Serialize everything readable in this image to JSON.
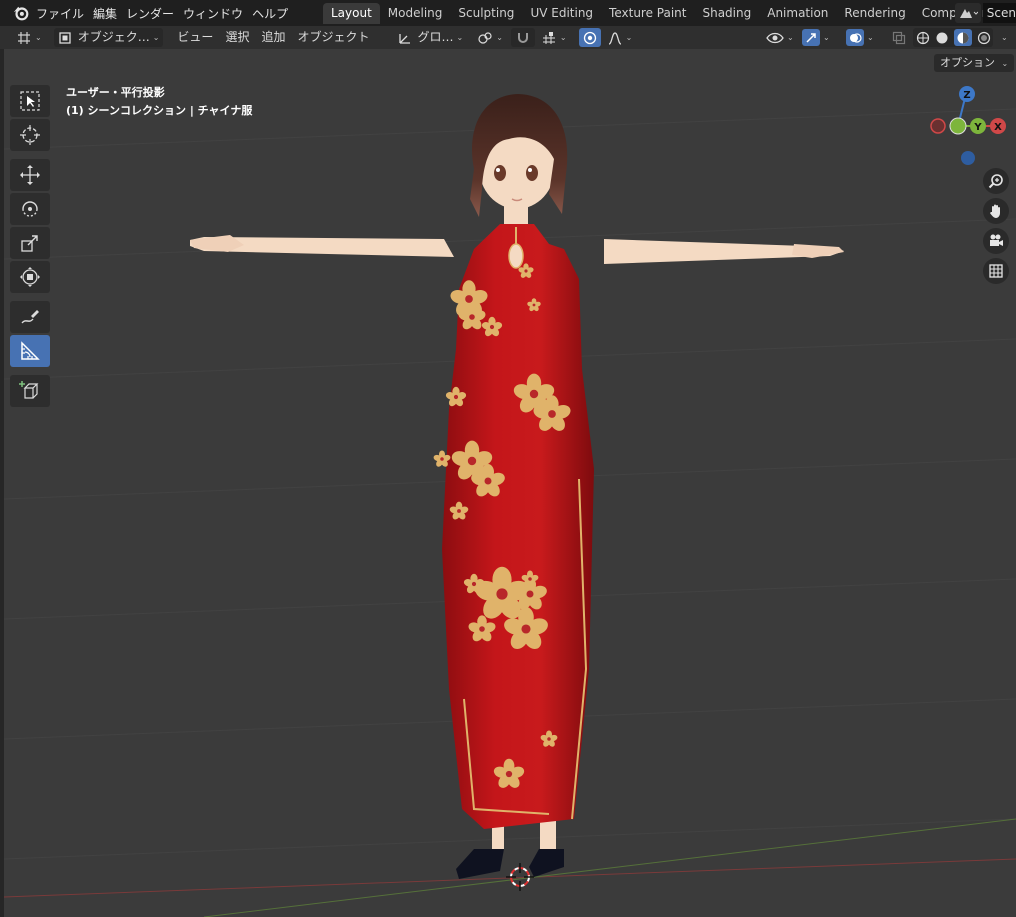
{
  "topbar": {
    "menus": [
      "ファイル",
      "編集",
      "レンダー",
      "ウィンドウ",
      "ヘルプ"
    ],
    "workspaces": [
      "Layout",
      "Modeling",
      "Sculpting",
      "UV Editing",
      "Texture Paint",
      "Shading",
      "Animation",
      "Rendering",
      "Compositing"
    ],
    "active_workspace": "Layout",
    "scene_label": "Scen"
  },
  "header": {
    "mode": "オブジェク…",
    "menus": [
      "ビュー",
      "選択",
      "追加",
      "オブジェクト"
    ],
    "transform_orientation": "グロ…",
    "options_label": "オプション"
  },
  "viewport": {
    "view_name": "ユーザー・平行投影",
    "collection_info": "(1) シーンコレクション | チャイナ服"
  },
  "colors": {
    "dress": "#b81418",
    "flower": "#e0b36a",
    "skin": "#f6ddc6",
    "hair": "#4b2a22",
    "accent": "#4772b3"
  },
  "toolbar": {
    "tools": [
      "select-box",
      "cursor",
      "move",
      "rotate",
      "scale",
      "transform",
      "annotate",
      "measure",
      "add-cube"
    ],
    "active_tool": "measure"
  }
}
